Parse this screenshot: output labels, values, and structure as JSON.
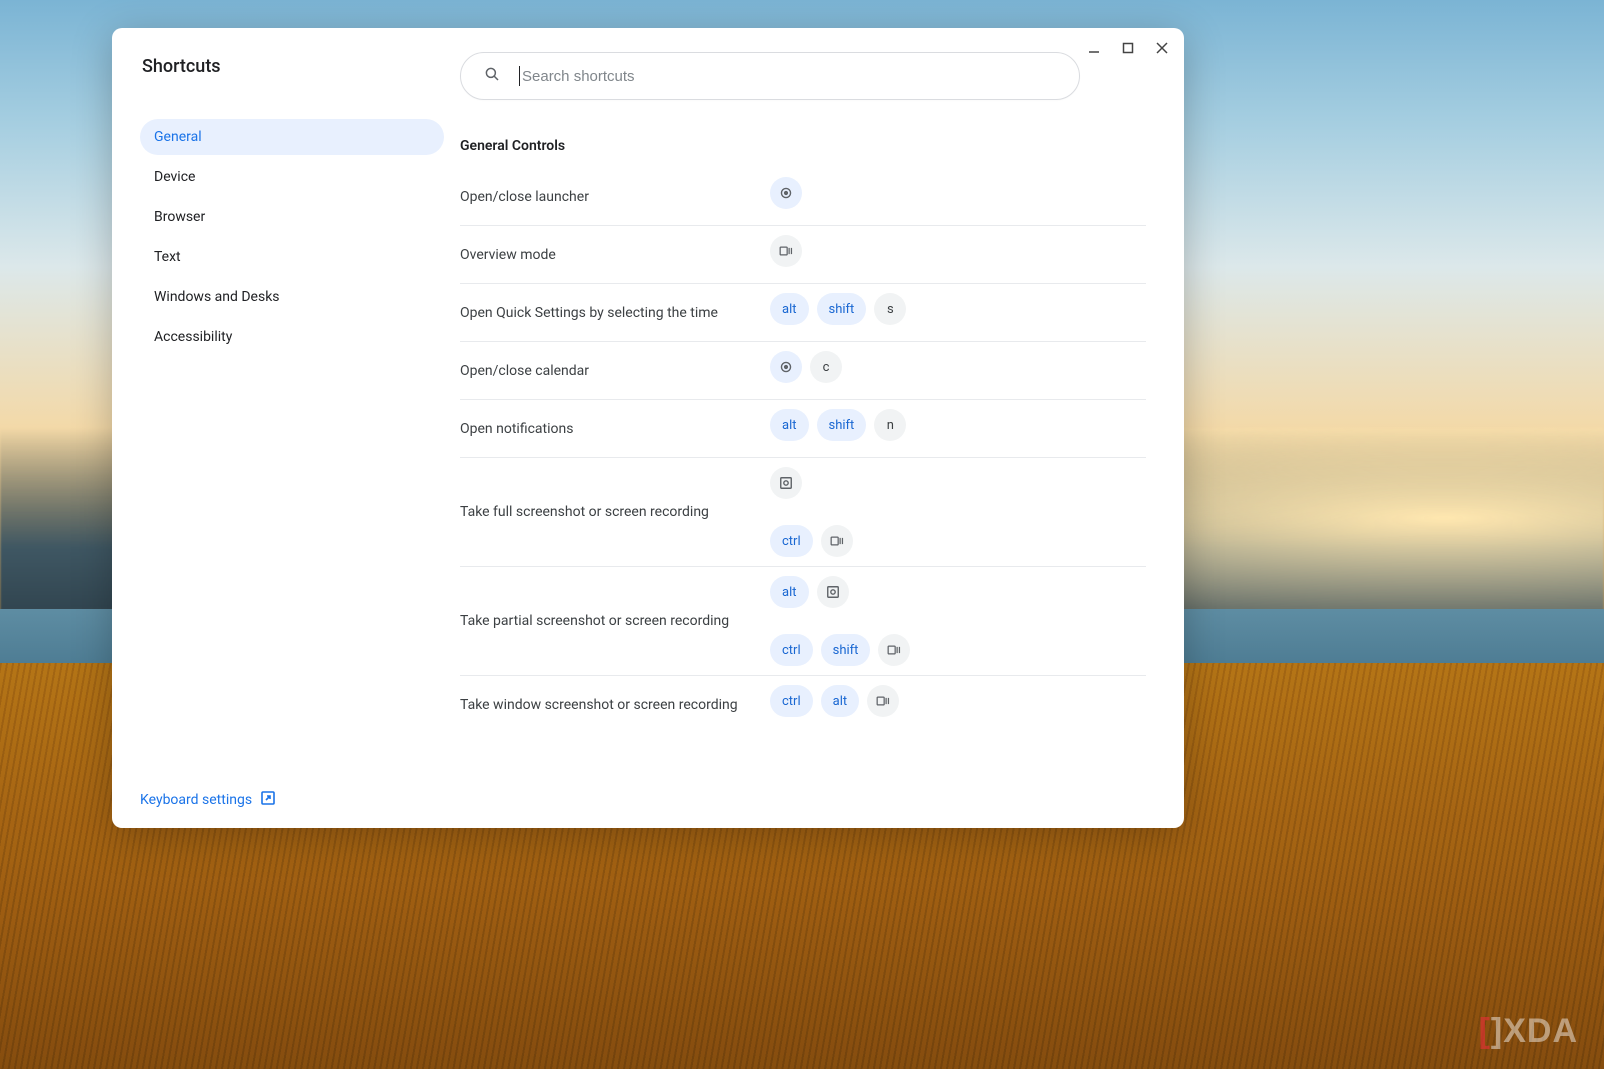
{
  "app": {
    "title": "Shortcuts",
    "search_placeholder": "Search shortcuts",
    "keyboard_settings": "Keyboard settings"
  },
  "sidebar": {
    "items": [
      {
        "label": "General",
        "active": true
      },
      {
        "label": "Device"
      },
      {
        "label": "Browser"
      },
      {
        "label": "Text"
      },
      {
        "label": "Windows and Desks"
      },
      {
        "label": "Accessibility"
      }
    ]
  },
  "section": {
    "title": "General Controls",
    "shortcuts": [
      {
        "label": "Open/close launcher",
        "combos": [
          [
            {
              "type": "icon",
              "icon": "launcher",
              "modifier": true
            }
          ]
        ]
      },
      {
        "label": "Overview mode",
        "combos": [
          [
            {
              "type": "icon",
              "icon": "overview"
            }
          ]
        ]
      },
      {
        "label": "Open Quick Settings by selecting the time",
        "combos": [
          [
            {
              "type": "text",
              "text": "alt",
              "modifier": true
            },
            {
              "type": "text",
              "text": "shift",
              "modifier": true
            },
            {
              "type": "text",
              "text": "s"
            }
          ]
        ]
      },
      {
        "label": "Open/close calendar",
        "combos": [
          [
            {
              "type": "icon",
              "icon": "launcher",
              "modifier": true
            },
            {
              "type": "text",
              "text": "c"
            }
          ]
        ]
      },
      {
        "label": "Open notifications",
        "combos": [
          [
            {
              "type": "text",
              "text": "alt",
              "modifier": true
            },
            {
              "type": "text",
              "text": "shift",
              "modifier": true
            },
            {
              "type": "text",
              "text": "n"
            }
          ]
        ]
      },
      {
        "label": "Take full screenshot or screen recording",
        "combos": [
          [
            {
              "type": "icon",
              "icon": "screenshot"
            }
          ],
          [
            {
              "type": "text",
              "text": "ctrl",
              "modifier": true
            },
            {
              "type": "icon",
              "icon": "overview"
            }
          ]
        ]
      },
      {
        "label": "Take partial screenshot or screen recording",
        "combos": [
          [
            {
              "type": "text",
              "text": "alt",
              "modifier": true
            },
            {
              "type": "icon",
              "icon": "screenshot"
            }
          ],
          [
            {
              "type": "text",
              "text": "ctrl",
              "modifier": true
            },
            {
              "type": "text",
              "text": "shift",
              "modifier": true
            },
            {
              "type": "icon",
              "icon": "overview"
            }
          ]
        ]
      },
      {
        "label": "Take window screenshot or screen recording",
        "combos": [
          [
            {
              "type": "text",
              "text": "ctrl",
              "modifier": true
            },
            {
              "type": "text",
              "text": "alt",
              "modifier": true
            },
            {
              "type": "icon",
              "icon": "overview"
            }
          ]
        ]
      }
    ]
  }
}
